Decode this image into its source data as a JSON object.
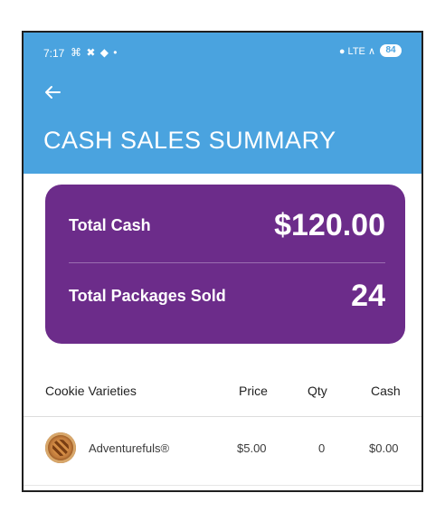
{
  "status_bar": {
    "time": "7:17",
    "left_icons": "⌘ ✖ ◆ •",
    "signal": "● LTE ∧",
    "battery": "84"
  },
  "header": {
    "title": "CASH SALES SUMMARY"
  },
  "summary_card": {
    "total_cash_label": "Total Cash",
    "total_cash_value": "$120.00",
    "total_packages_label": "Total Packages Sold",
    "total_packages_value": "24"
  },
  "table": {
    "columns": [
      "Cookie Varieties",
      "Price",
      "Qty",
      "Cash"
    ],
    "rows": [
      {
        "name": "Adventurefuls®",
        "price": "$5.00",
        "qty": "0",
        "cash": "$0.00"
      }
    ]
  },
  "colors": {
    "appbar": "#4aa3df",
    "card": "#6c2c8a"
  },
  "icons": {
    "back": "arrow-left-icon",
    "cookie": "cookie-icon"
  }
}
